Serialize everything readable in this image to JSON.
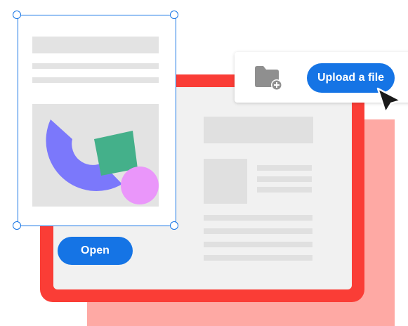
{
  "buttons": {
    "open_label": "Open",
    "upload_label": "Upload a file"
  },
  "icons": {
    "folder": "folder-add-icon",
    "cursor": "mouse-pointer-icon",
    "handles": "resize-handle-icon"
  },
  "colors": {
    "accent_blue": "#1574e5",
    "frame_red": "#fa3d36",
    "shadow_pink": "#fea9a4",
    "shape_purple": "#7b78fb",
    "shape_green": "#44b08a",
    "shape_pink": "#ea96fa",
    "placeholder_gray": "#e0e0e0",
    "folder_gray": "#8f8f8f"
  }
}
